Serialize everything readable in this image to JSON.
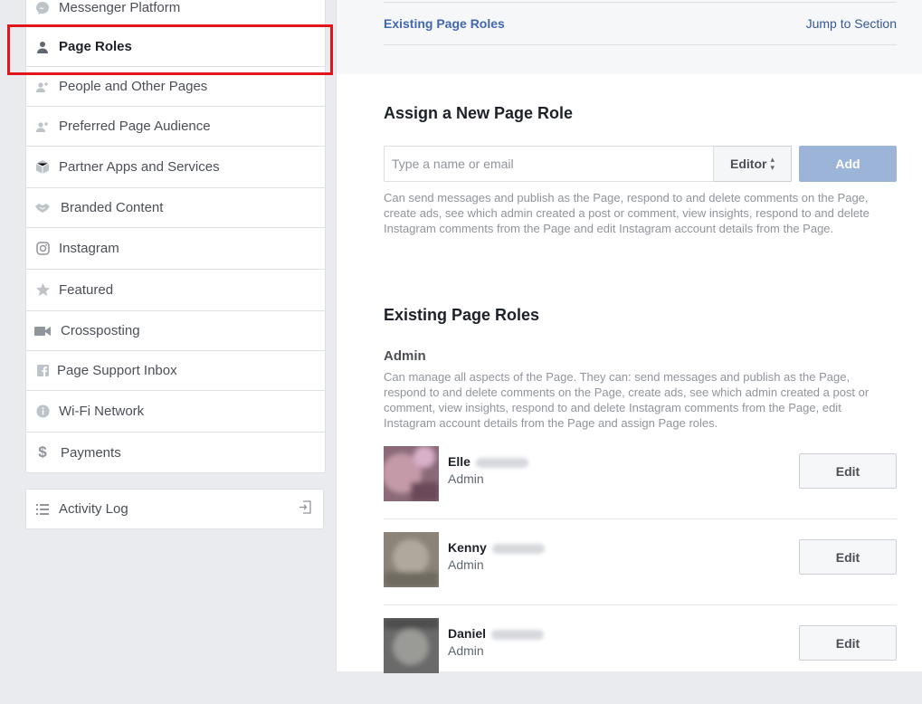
{
  "sidebar": {
    "items": [
      {
        "label": "Messenger Platform",
        "icon": "messenger-icon"
      },
      {
        "label": "Page Roles",
        "icon": "person-icon",
        "active": true
      },
      {
        "label": "People and Other Pages",
        "icon": "people-icon"
      },
      {
        "label": "Preferred Page Audience",
        "icon": "people-icon"
      },
      {
        "label": "Partner Apps and Services",
        "icon": "cube-icon"
      },
      {
        "label": "Branded Content",
        "icon": "handshake-icon"
      },
      {
        "label": "Instagram",
        "icon": "instagram-icon"
      },
      {
        "label": "Featured",
        "icon": "star-icon"
      },
      {
        "label": "Crossposting",
        "icon": "video-icon"
      },
      {
        "label": "Page Support Inbox",
        "icon": "facebook-icon"
      },
      {
        "label": "Wi-Fi Network",
        "icon": "info-icon"
      },
      {
        "label": "Payments",
        "icon": "dollar-icon"
      }
    ],
    "activity_log": {
      "label": "Activity Log",
      "icon": "list-icon"
    }
  },
  "topbar": {
    "title": "Existing Page Roles",
    "jump": "Jump to Section"
  },
  "assign": {
    "heading": "Assign a New Page Role",
    "placeholder": "Type a name or email",
    "role": "Editor",
    "add_label": "Add",
    "description": "Can send messages and publish as the Page, respond to and delete comments on the Page, create ads, see which admin created a post or comment, view insights, respond to and delete Instagram comments from the Page and edit Instagram account details from the Page."
  },
  "existing": {
    "heading": "Existing Page Roles",
    "admin_heading": "Admin",
    "admin_description": "Can manage all aspects of the Page. They can: send messages and publish as the Page, respond to and delete comments on the Page, create ads, see which admin created a post or comment, view insights, respond to and delete Instagram comments from the Page, edit Instagram account details from the Page and assign Page roles.",
    "people": [
      {
        "name": "Elle",
        "role": "Admin",
        "edit": "Edit"
      },
      {
        "name": "Kenny",
        "role": "Admin",
        "edit": "Edit"
      },
      {
        "name": "Daniel",
        "role": "Admin",
        "edit": "Edit"
      }
    ]
  },
  "colors": {
    "link": "#4267b2",
    "highlight": "#e0161c",
    "add_button": "#9cb4d8"
  }
}
